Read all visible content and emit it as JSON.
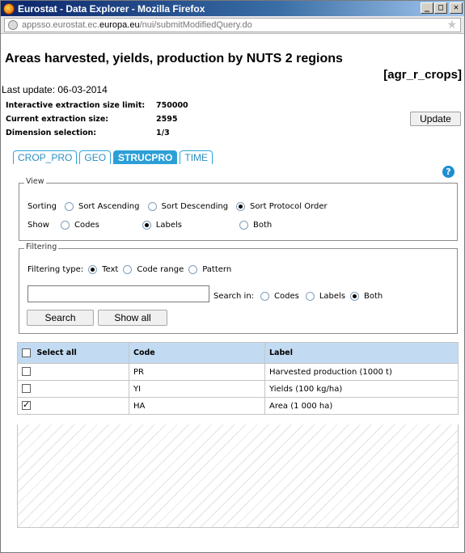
{
  "window": {
    "title": "Eurostat - Data Explorer - Mozilla Firefox",
    "buttons": {
      "minimize": "_",
      "maximize": "□",
      "close": "✕"
    }
  },
  "url": {
    "prefix": "appsso.eurostat.ec.",
    "domain": "europa.eu",
    "path": "/nui/submitModifiedQuery.do"
  },
  "page": {
    "title": "Areas harvested, yields, production by NUTS 2 regions",
    "code": "[agr_r_crops]",
    "last_update": "Last update: 06-03-2014",
    "info": [
      {
        "label": "Interactive extraction size limit:",
        "value": "750000"
      },
      {
        "label": "Current extraction size:",
        "value": "2595"
      },
      {
        "label": "Dimension selection:",
        "value": "1/3"
      }
    ],
    "update_label": "Update"
  },
  "tabs": [
    {
      "label": "CROP_PRO",
      "active": false
    },
    {
      "label": "GEO",
      "active": false
    },
    {
      "label": "STRUCPRO",
      "active": true
    },
    {
      "label": "TIME",
      "active": false
    }
  ],
  "view": {
    "legend": "View",
    "sorting_label": "Sorting",
    "sorting_options": [
      "Sort Ascending",
      "Sort Descending",
      "Sort Protocol Order"
    ],
    "show_label": "Show",
    "show_options": [
      "Codes",
      "Labels",
      "Both"
    ]
  },
  "filtering": {
    "legend": "Filtering",
    "type_label": "Filtering type:",
    "type_options": [
      "Text",
      "Code range",
      "Pattern"
    ],
    "search_value": "",
    "search_in_label": "Search in:",
    "search_in_options": [
      "Codes",
      "Labels",
      "Both"
    ],
    "search_button": "Search",
    "show_all_button": "Show all"
  },
  "table": {
    "headers": [
      "Select all",
      "Code",
      "Label"
    ],
    "rows": [
      {
        "checked": false,
        "code": "PR",
        "label": "Harvested production (1000 t)"
      },
      {
        "checked": false,
        "code": "YI",
        "label": "Yields (100 kg/ha)"
      },
      {
        "checked": true,
        "code": "HA",
        "label": "Area (1 000 ha)"
      }
    ]
  },
  "colors": {
    "tab_accent": "#2d9fd8",
    "table_header": "#c2dbf2",
    "titlebar": "#0a246a"
  }
}
